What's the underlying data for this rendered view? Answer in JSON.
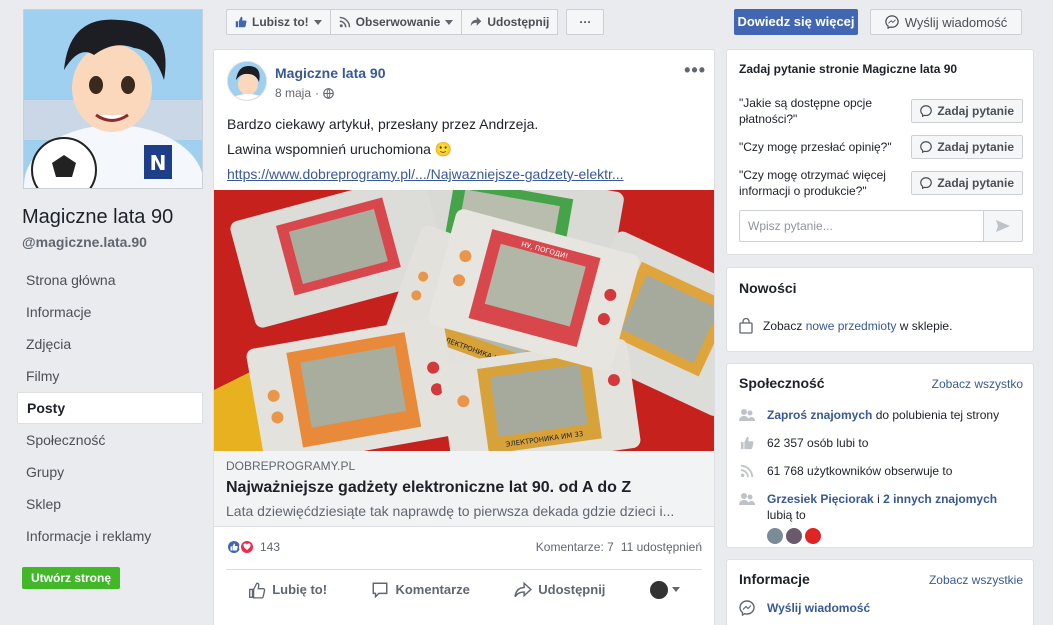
{
  "page": {
    "name": "Magiczne lata 90",
    "handle": "@magiczne.lata.90"
  },
  "nav": {
    "items": [
      {
        "label": "Strona główna"
      },
      {
        "label": "Informacje"
      },
      {
        "label": "Zdjęcia"
      },
      {
        "label": "Filmy"
      },
      {
        "label": "Posty"
      },
      {
        "label": "Społeczność"
      },
      {
        "label": "Grupy"
      },
      {
        "label": "Sklep"
      },
      {
        "label": "Informacje i reklamy"
      }
    ],
    "create_page": "Utwórz stronę"
  },
  "toolbar": {
    "like": "Lubisz to!",
    "follow": "Obserwowanie",
    "share": "Udostępnij",
    "more": "···",
    "learn_more": "Dowiedz się więcej",
    "send_message": "Wyślij wiadomość"
  },
  "post": {
    "author": "Magiczne lata 90",
    "date": "8 maja",
    "line1": "Bardzo ciekawy artykuł, przesłany przez Andrzeja.",
    "line2": "Lawina wspomnień uruchomiona 🙂",
    "url": "https://www.dobreprogramy.pl/.../Najwazniejsze-gadzety-elektr...",
    "link_domain": "DOBREPROGRAMY.PL",
    "link_title": "Najważniejsze gadżety elektroniczne lat 90. od A do Z",
    "link_desc": "Lata dziewięćdziesiąte tak naprawdę to pierwsza dekada gdzie dzieci i...",
    "reactions_count": "143",
    "comments": "Komentarze: 7",
    "shares": "11 udostępnień",
    "action_like": "Lubię to!",
    "action_comment": "Komentarze",
    "action_share": "Udostępnij",
    "device_labels": [
      "НУ, ПОГОДИ!",
      "ЭЛЕКТРОНИКА ИМ 02",
      "ЭЛЕКТРОНИКА ИМ 33"
    ]
  },
  "ask": {
    "title": "Zadaj pytanie stronie Magiczne lata 90",
    "questions": [
      {
        "q": "\"Jakie są dostępne opcje płatności?\"",
        "btn": "Zadaj pytanie"
      },
      {
        "q": "\"Czy mogę przesłać opinię?\"",
        "btn": "Zadaj pytanie"
      },
      {
        "q": "\"Czy mogę otrzymać więcej informacji o produkcie?\"",
        "btn": "Zadaj pytanie"
      }
    ],
    "placeholder": "Wpisz pytanie..."
  },
  "news": {
    "title": "Nowości",
    "pre": "Zobacz ",
    "link": "nowe przedmioty",
    "post": " w sklepie."
  },
  "community": {
    "title": "Społeczność",
    "see_all": "Zobacz wszystko",
    "invite_link": "Zaproś znajomych",
    "invite_rest": " do polubienia tej strony",
    "likes": "62 357 osób lubi to",
    "followers": "61 768 użytkowników obserwuje to",
    "friend_name": "Grzesiek Pięciorak",
    "friend_and": " i ",
    "friend_others": "2 innych znajomych",
    "friend_likes": "lubią to"
  },
  "info": {
    "title": "Informacje",
    "see_all": "Zobacz wszystkie",
    "send_message": "Wyślij wiadomość"
  },
  "colors": {
    "fb_blue": "#4267b2",
    "link": "#385898",
    "green": "#42b72a",
    "bg": "#e9ebee"
  }
}
